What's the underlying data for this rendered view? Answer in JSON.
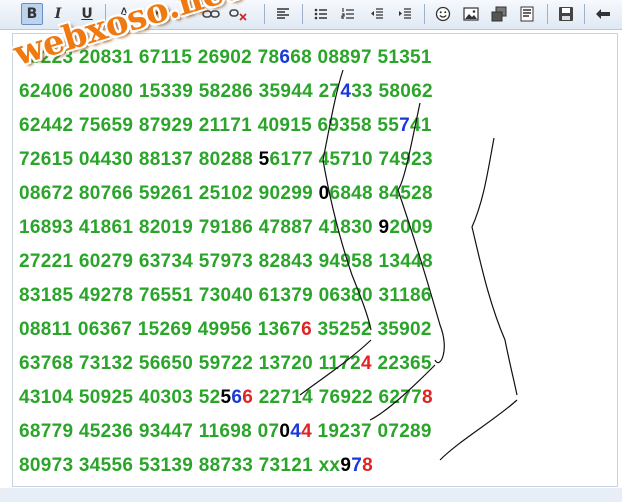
{
  "toolbar": {
    "buttons": [
      {
        "name": "bold-button",
        "glyph": "B",
        "active": true
      },
      {
        "name": "italic-button",
        "glyph": "I"
      },
      {
        "name": "underline-button",
        "glyph": "U"
      },
      {
        "name": "font-color-button",
        "glyph": "A"
      },
      {
        "name": "font-size-button",
        "glyph": "A"
      },
      {
        "name": "insert-link-button",
        "icon": "link-icon"
      },
      {
        "name": "remove-link-button",
        "icon": "unlink-icon"
      },
      {
        "name": "align-left-button",
        "icon": "align-left-icon"
      },
      {
        "name": "bullet-list-button",
        "icon": "bullet-list-icon"
      },
      {
        "name": "numbered-list-button",
        "icon": "numbered-list-icon"
      },
      {
        "name": "outdent-button",
        "icon": "outdent-icon"
      },
      {
        "name": "indent-button",
        "icon": "indent-icon"
      },
      {
        "name": "emoticon-button",
        "icon": "smiley-icon"
      },
      {
        "name": "insert-image-button",
        "icon": "image-icon"
      },
      {
        "name": "insert-media-button",
        "icon": "media-icon"
      },
      {
        "name": "insert-code-button",
        "icon": "code-icon"
      },
      {
        "name": "save-button",
        "icon": "floppy-disk-icon"
      },
      {
        "name": "undo-button",
        "icon": "undo-arrow-icon"
      }
    ]
  },
  "watermark": "webxoso.net",
  "rows": [
    [
      {
        "t": "58223 "
      },
      {
        "t": "20831 67115 26902 78"
      },
      {
        "t": "6",
        "c": "blue"
      },
      {
        "t": "68 08897 51351"
      }
    ],
    [
      {
        "t": "62406 20080 15339 58286 35944 27"
      },
      {
        "t": "4",
        "c": "blue"
      },
      {
        "t": "33 58062"
      }
    ],
    [
      {
        "t": "62442 75659 87929 21171 40915 69358 55"
      },
      {
        "t": "7",
        "c": "blue"
      },
      {
        "t": "41"
      }
    ],
    [
      {
        "t": "72615 04430 88137 80288 "
      },
      {
        "t": "5",
        "c": "black"
      },
      {
        "t": "6177 45710 74923"
      }
    ],
    [
      {
        "t": "08672 80766 59261 25102 90299 "
      },
      {
        "t": "0",
        "c": "black"
      },
      {
        "t": "6848 84528"
      }
    ],
    [
      {
        "t": "16893 41861 82019 79186 47887 41830 "
      },
      {
        "t": "9",
        "c": "black"
      },
      {
        "t": "2009"
      }
    ],
    [
      {
        "t": "27221 60279 63734 57973 82843 94958 13448"
      }
    ],
    [
      {
        "t": "83185 49278 76551 73040 61379 06380 31186"
      }
    ],
    [
      {
        "t": "08811 06367 15269 49956 1367"
      },
      {
        "t": "6",
        "c": "red"
      },
      {
        "t": " 35252 35902"
      }
    ],
    [
      {
        "t": "63768 73132 56650 59722 13720 1172"
      },
      {
        "t": "4",
        "c": "red"
      },
      {
        "t": " 22365"
      }
    ],
    [
      {
        "t": "43104 50925 40303 52"
      },
      {
        "t": "5",
        "c": "black"
      },
      {
        "t": "6",
        "c": "blue"
      },
      {
        "t": "6",
        "c": "red"
      },
      {
        "t": " 22714 76922 6277"
      },
      {
        "t": "8",
        "c": "red"
      }
    ],
    [
      {
        "t": "68779 45236 93447 11698 07"
      },
      {
        "t": "0",
        "c": "black"
      },
      {
        "t": "4",
        "c": "blue"
      },
      {
        "t": "4",
        "c": "red"
      },
      {
        "t": " 19237 07289"
      }
    ],
    [
      {
        "t": "80973 34556 53139 88733 73121 xx"
      },
      {
        "t": "9",
        "c": "black"
      },
      {
        "t": "7",
        "c": "blue"
      },
      {
        "t": "8",
        "c": "red"
      }
    ]
  ]
}
